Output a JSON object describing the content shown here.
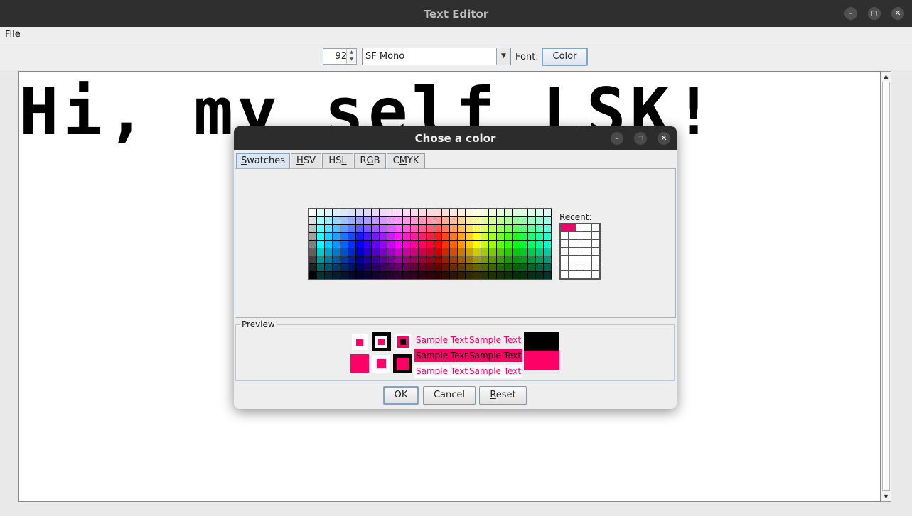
{
  "window": {
    "title": "Text Editor",
    "minimize": "–",
    "maximize": "◻",
    "close": "✕"
  },
  "menubar": {
    "file": "File"
  },
  "toolbar": {
    "font_size": "92",
    "font_name": "SF Mono",
    "font_label": "Font:",
    "color_button": "Color"
  },
  "editor": {
    "text": "Hi, my self LSK!"
  },
  "dialog": {
    "title": "Chose a color",
    "tabs": [
      {
        "pre": "",
        "mn": "S",
        "post": "watches"
      },
      {
        "pre": "",
        "mn": "H",
        "post": "SV"
      },
      {
        "pre": "HS",
        "mn": "L",
        "post": ""
      },
      {
        "pre": "R",
        "mn": "G",
        "post": "B"
      },
      {
        "pre": "C",
        "mn": "M",
        "post": "YK"
      }
    ],
    "recent_label": "Recent:",
    "recent_colors": [
      "#e8086a",
      "#e8086a"
    ],
    "preview_label": "Preview",
    "sample_text": "Sample Text",
    "selected_color": "#ff0066",
    "ok": "OK",
    "cancel": "Cancel",
    "reset": {
      "mn": "R",
      "post": "eset"
    }
  },
  "colors": {
    "accent": "#ff0066",
    "titlebar": "#2f2f2f",
    "dialog_title": "#2c2c2c"
  }
}
